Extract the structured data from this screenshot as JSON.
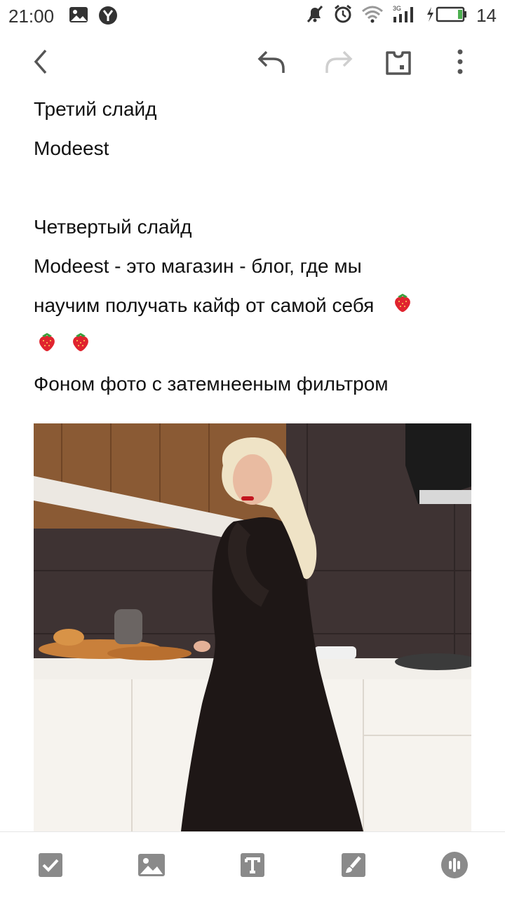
{
  "status_bar": {
    "time": "21:00",
    "battery_level": "14",
    "network_label": "3G"
  },
  "app_bar": {
    "back_icon": "chevron-left-icon",
    "undo_icon": "undo-icon",
    "redo_icon": "redo-icon",
    "tag_icon": "tag-icon",
    "menu_icon": "more-vert-icon"
  },
  "note": {
    "lines": [
      "Третий слайд",
      "Modeest",
      "",
      "Четвертый слайд",
      "Modeest - это магазин - блог,  где мы",
      "научим получать кайф от самой себя",
      "",
      "Фоном фото с затемнееным фильтром"
    ],
    "emoji_icon": "strawberry-icon"
  },
  "toolbar": {
    "items": [
      "checkbox-icon",
      "image-icon",
      "text-format-icon",
      "brush-icon",
      "voice-icon"
    ]
  },
  "colors": {
    "icon_gray": "#6b6b6b",
    "toolbar_gray": "#8a8a8a"
  }
}
